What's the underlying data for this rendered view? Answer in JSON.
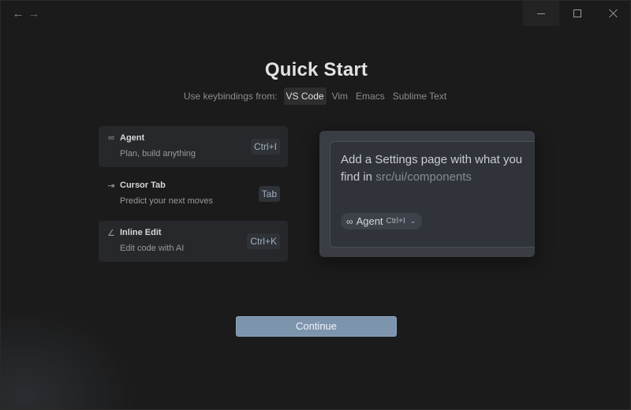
{
  "titlebar": {
    "back_icon": "arrow-left-icon",
    "forward_icon": "arrow-right-icon",
    "controls": [
      "minimize",
      "maximize",
      "close"
    ]
  },
  "title": "Quick Start",
  "keybindings": {
    "label": "Use keybindings from:",
    "options": [
      "VS Code",
      "Vim",
      "Emacs",
      "Sublime Text"
    ],
    "selected": "VS Code"
  },
  "features": [
    {
      "icon": "infinity-icon",
      "name": "Agent",
      "description": "Plan, build anything",
      "shortcut": "Ctrl+I",
      "highlighted": true
    },
    {
      "icon": "tab-arrow-icon",
      "name": "Cursor Tab",
      "description": "Predict your next moves",
      "shortcut": "Tab",
      "highlighted": false
    },
    {
      "icon": "pencil-icon",
      "name": "Inline Edit",
      "description": "Edit code with AI",
      "shortcut": "Ctrl+K",
      "highlighted": true
    }
  ],
  "preview": {
    "prompt": "Add a Settings page with what you find in",
    "path": "src/ui/components",
    "agent": {
      "icon": "infinity-icon",
      "label": "Agent",
      "shortcut": "Ctrl+I"
    }
  },
  "continue_label": "Continue",
  "colors": {
    "background": "#1b1b1b",
    "accent": "#7d94ad",
    "card": "#3a3e44"
  }
}
